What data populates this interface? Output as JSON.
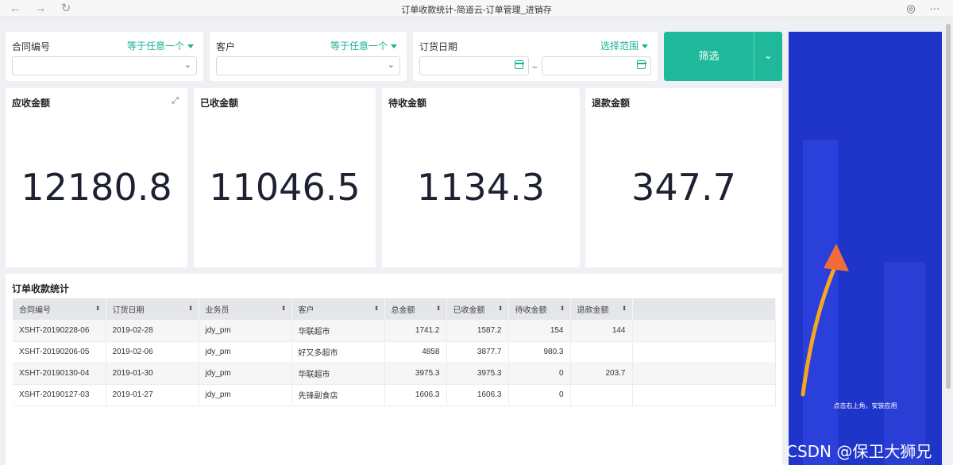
{
  "window": {
    "title": "订单收款统计-简道云-订单管理_进销存"
  },
  "filters": [
    {
      "label": "合同编号",
      "operator": "等于任意一个"
    },
    {
      "label": "客户",
      "operator": "等于任意一个"
    },
    {
      "label": "订货日期",
      "operator": "选择范围",
      "separator": "~"
    }
  ],
  "filter_button": {
    "label": "筛选"
  },
  "cards": [
    {
      "title": "应收金额",
      "value": "12180.8"
    },
    {
      "title": "已收金额",
      "value": "11046.5"
    },
    {
      "title": "待收金额",
      "value": "1134.3"
    },
    {
      "title": "退款金额",
      "value": "347.7"
    }
  ],
  "table": {
    "title": "订单收款统计",
    "columns": [
      "合同编号",
      "订货日期",
      "业务员",
      "客户",
      "总金额",
      "已收金额",
      "待收金额",
      "退款金额"
    ],
    "rows": [
      [
        "XSHT-20190228-06",
        "2019-02-28",
        "jdy_pm",
        "华联超市",
        "1741.2",
        "1587.2",
        "154",
        "144"
      ],
      [
        "XSHT-20190206-05",
        "2019-02-06",
        "jdy_pm",
        "好又多超市",
        "4858",
        "3877.7",
        "980.3",
        ""
      ],
      [
        "XSHT-20190130-04",
        "2019-01-30",
        "jdy_pm",
        "华联超市",
        "3975.3",
        "3975.3",
        "0",
        "203.7"
      ],
      [
        "XSHT-20190127-03",
        "2019-01-27",
        "jdy_pm",
        "先锋副食店",
        "1606.3",
        "1606.3",
        "0",
        ""
      ]
    ]
  },
  "promo": {
    "text": "点击右上角，安装应用"
  },
  "watermark": "CSDN @保卫大狮兄",
  "icons": {
    "back": "arrow-left-icon",
    "forward": "arrow-right-icon",
    "refresh": "refresh-icon",
    "browser": "chrome-icon",
    "more": "more-icon"
  },
  "colors": {
    "accent": "#1fb89a",
    "promo_bg": "#1f34c8",
    "value_text": "#1d2233"
  }
}
